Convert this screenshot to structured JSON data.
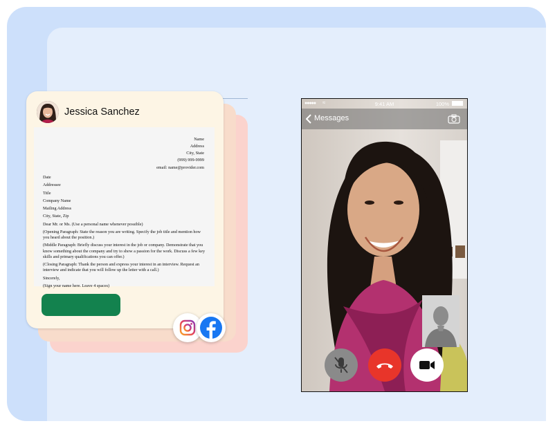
{
  "contact": {
    "name": "Jessica Sanchez"
  },
  "letter": {
    "header_lines": [
      "Name",
      "Address",
      "City, State",
      "(999) 999-9999",
      "email: name@provider.com"
    ],
    "body_lines": [
      "Date",
      "Addressee",
      "Title",
      "Company Name",
      "Mailing Address",
      "City, State, Zip",
      "Dear Mr. or Ms. (Use a personal name whenever possible)"
    ],
    "opening_paragraph": "(Opening Paragraph: State the reason you are writing. Specify the job title and mention how you heard about the position.)",
    "middle_paragraph": "(Middle Paragraph: Briefly discuss your interest in the job or company. Demonstrate that you know something about the company and try to show a passion for the work. Discuss a few key skills and primary qualifications you can offer.)",
    "closing_paragraph": "(Closing Paragraph: Thank the person and express your interest in an interview. Request an interview and indicate that you will follow up the letter with a call.)",
    "closing": "Sincerely,",
    "signature": "(Sign your name here. Leave 4 spaces)"
  },
  "social_icons": [
    "instagram-icon",
    "facebook-icon"
  ],
  "phone": {
    "status": {
      "time": "9:41 AM",
      "battery": "100%"
    },
    "nav": {
      "back_label": "Messages"
    },
    "controls": [
      "mute-microphone-icon",
      "end-call-icon",
      "video-camera-icon"
    ]
  },
  "colors": {
    "accent_green": "#13824e",
    "end_call_red": "#e8352a",
    "facebook_blue": "#1877f2",
    "background_blue": "#cde0fb"
  }
}
